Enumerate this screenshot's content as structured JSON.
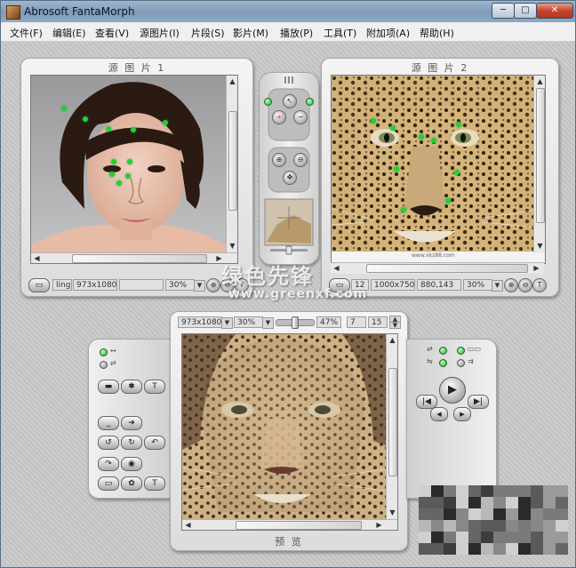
{
  "window": {
    "title": "Abrosoft FantaMorph",
    "min_label": "─",
    "max_label": "□",
    "close_label": "✕"
  },
  "menu": [
    "文件(F)",
    "编辑(E)",
    "查看(V)",
    "源图片(I)",
    "片段(S)",
    "影片(M)",
    "播放(P)",
    "工具(T)",
    "附加项(A)",
    "帮助(H)"
  ],
  "source1": {
    "title": "源 图 片 1",
    "name": "ling",
    "size": "973x1080",
    "zoom": "30%"
  },
  "source2": {
    "title": "源 图 片 2",
    "name": "12",
    "size": "1000x750",
    "coords": "880,143",
    "zoom": "30%",
    "photo_caption": "www.xkz88.com"
  },
  "preview": {
    "title": "预 览",
    "size": "973x1080",
    "zoom": "30%",
    "morph_percent": "47%",
    "frame": "7",
    "frame_total": "15",
    "morph_level": 0.47
  },
  "toolbox_icons": [
    "pointer-icon",
    "add-key-point-icon",
    "remove-key-point-icon",
    "zoom-in-icon",
    "zoom-out-icon",
    "pan-icon"
  ],
  "left_tools": {
    "buttons": [
      "▬",
      "✱",
      "T",
      "⎵",
      "➜",
      "↺",
      "↻",
      "↶",
      "↷",
      "◉",
      "▭",
      "✿",
      "T"
    ]
  },
  "right_controls": {
    "play": "▶",
    "prev": "|◀",
    "next": "▶|",
    "rew": "◀◀",
    "fwd": "▶▶",
    "step_back": "◀",
    "step_fwd": "▶"
  },
  "watermark": {
    "line1": "绿色先锋",
    "line2": "www.greenxf.com"
  },
  "colors": {
    "key_point": "#22d22e",
    "title_bar": "#8fa9c4",
    "panel": "#e6e6e6"
  }
}
